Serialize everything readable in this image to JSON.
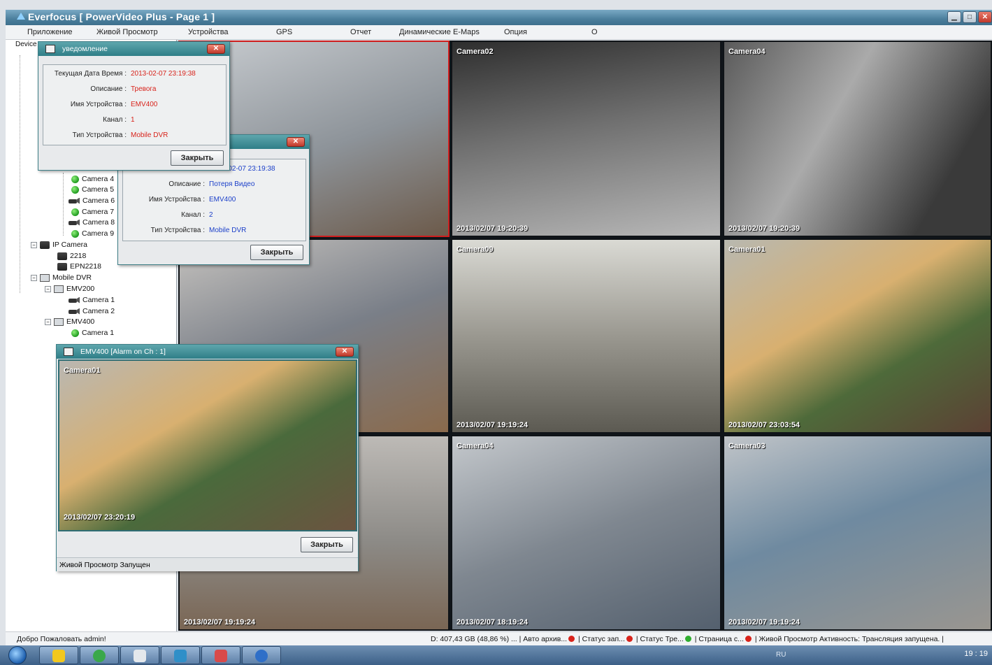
{
  "app": {
    "title": "Everfocus  [ PowerVideo Plus - Page 1 ]",
    "win_min": "▁",
    "win_max": "□",
    "win_close": "✕"
  },
  "menu": [
    "Приложение",
    "Живой Просмотр",
    "Устройства",
    "GPS",
    "Отчет",
    "Динамические E-Maps",
    "Опция",
    "О"
  ],
  "tree": {
    "header": "Device",
    "cameras_top": [
      "Camera 4",
      "Camera 5",
      "Camera 6",
      "Camera 7",
      "Camera 8",
      "Camera 9"
    ],
    "ip_camera": "IP Camera",
    "ip_items": [
      "2218",
      "EPN2218"
    ],
    "mobile_dvr": "Mobile DVR",
    "emv200": "EMV200",
    "emv200_items": [
      "Camera 1",
      "Camera 2"
    ],
    "emv400": "EMV400",
    "emv400_items": [
      "Camera 1"
    ]
  },
  "tiles": [
    {
      "label": "",
      "time": ""
    },
    {
      "label": "Camera02",
      "time": "2013/02/07  19:20:39"
    },
    {
      "label": "Camera04",
      "time": "2013/02/07  19:20:39"
    },
    {
      "label": "",
      "time": ""
    },
    {
      "label": "Camera09",
      "time": "2013/02/07  19:19:24"
    },
    {
      "label": "Camera01",
      "time": "2013/02/07  23:03:54"
    },
    {
      "label": "",
      "time": "2013/02/07  19:19:24"
    },
    {
      "label": "Camera04",
      "time": "2013/02/07  18:19:24"
    },
    {
      "label": "Camera03",
      "time": "2013/02/07  19:19:24"
    }
  ],
  "notify1": {
    "title": "уведомление",
    "close_x": "✕",
    "labels": [
      "Текущая Дата Время :",
      "Описание :",
      "Имя Устройства :",
      "Канал :",
      "Тип Устройства :"
    ],
    "values": [
      "2013-02-07 23:19:38",
      "Тревога",
      "EMV400",
      "1",
      "Mobile DVR"
    ],
    "button": "Закрыть"
  },
  "notify2": {
    "close_x": "✕",
    "datetime_partial": "-02-07 23:19:38",
    "labels": [
      "Описание :",
      "Имя Устройства :",
      "Канал :",
      "Тип Устройства :"
    ],
    "values": [
      "Потеря Видео",
      "EMV400",
      "2",
      "Mobile DVR"
    ],
    "button": "Закрыть"
  },
  "alarm": {
    "title": "EMV400 [Alarm on Ch : 1]",
    "close_x": "✕",
    "cam_label": "Camera01",
    "time": "2013/02/07  23:20:19",
    "button": "Закрыть",
    "status": "Живой Просмотр Запущен"
  },
  "status": {
    "welcome": "Добро Пожаловать admin!",
    "disk": "D: 407,43 GB (48,86 %) ... |",
    "auto": "Авто архив...",
    "rec": "| Статус зап...",
    "alarm": "| Статус Тре...",
    "page": "| Страница с...",
    "live": "| Живой Просмотр",
    "activity": "Активность: Трансляция запущена. |"
  },
  "taskbar": {
    "lang": "RU",
    "clock": "19 : 19"
  },
  "colors": {
    "alarm_value": "#d8231b",
    "video_loss_value": "#1b3fc9",
    "active_tile_border": "#d01e1e"
  }
}
